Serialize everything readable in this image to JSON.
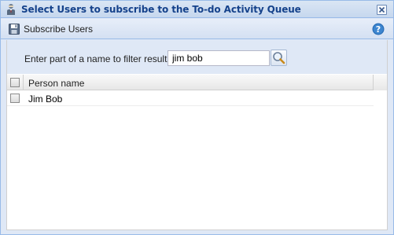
{
  "dialog": {
    "title": "Select Users to subscribe to the To-do Activity Queue",
    "title_icon": "user-icon",
    "close_icon": "close-icon"
  },
  "toolbar": {
    "subscribe_label": "Subscribe Users",
    "subscribe_icon": "floppy-disk-icon",
    "help_icon": "help-icon"
  },
  "filter": {
    "label": "Enter part of a name to filter results",
    "value": "jim bob",
    "search_icon": "magnifier-icon"
  },
  "grid": {
    "columns": [
      "Person name"
    ],
    "rows": [
      {
        "person_name": "Jim Bob",
        "checked": false
      }
    ],
    "select_all_checked": false
  },
  "colors": {
    "title_text": "#15428b",
    "panel_bg": "#dfe8f6",
    "border": "#99bbe8"
  }
}
